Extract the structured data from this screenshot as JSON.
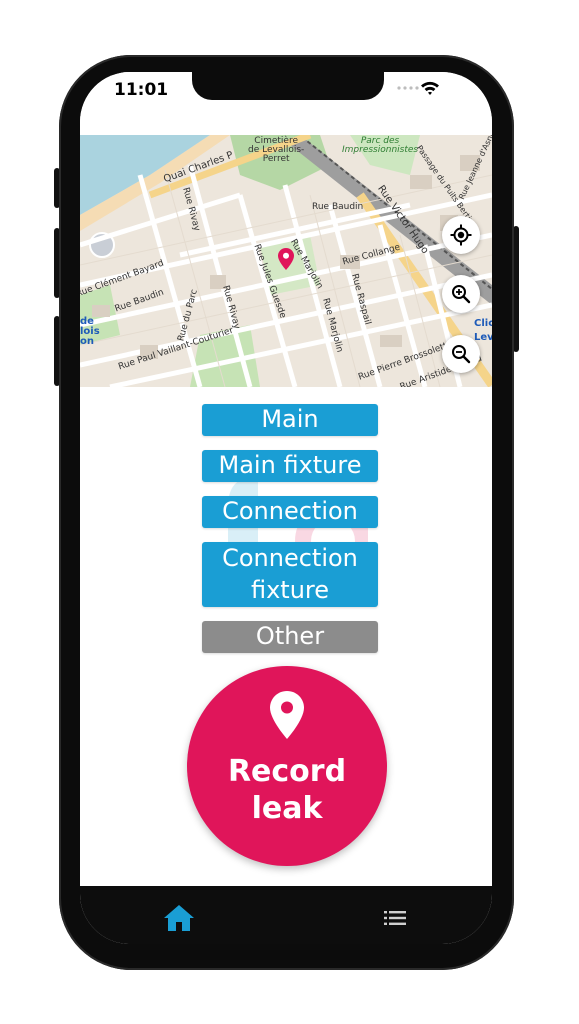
{
  "status_bar": {
    "time": "11:01"
  },
  "map": {
    "labels": {
      "quai": "Quai Charles P",
      "cimetiere": "Cimetière\nde Levallois-\nPerret",
      "parc": "Parc des\nImpressionnistes",
      "baudin_top": "Rue Baudin",
      "victor_hugo": "Rue Victor Hugo",
      "collange": "Rue Collange",
      "marjolin": "Rue Marjolin",
      "rivay": "Rue Rivay",
      "clement_bayard": "Rue Clément Bayard",
      "baudin_left": "Rue Baudin",
      "du_parc": "Rue du Parc",
      "paul_vaillant": "Rue Paul Vaillant-Couturier",
      "jules_guesde": "Rue Jules Guesde",
      "rivay_lower": "Rue Rivay",
      "raspail": "Rue Raspail",
      "marjolin_lower": "Rue Marjolin",
      "brossolette": "Rue Pierre Brossolette",
      "aristide": "Rue Aristide Briand",
      "passage": "Passage du Puits Bertin",
      "jeanne": "Rue Jeanne d'Asnières",
      "clic": "Clic",
      "leva": "Leva",
      "left_blue": "de\nlois\non"
    },
    "controls": {
      "locate_icon": "crosshair-locate-icon",
      "zoom_in_icon": "zoom-in-icon",
      "zoom_out_icon": "zoom-out-icon"
    }
  },
  "categories": [
    {
      "label": "Main"
    },
    {
      "label": "Main fixture"
    },
    {
      "label": "Connection"
    },
    {
      "label": "Connection\nfixture"
    },
    {
      "label": "Other"
    }
  ],
  "record": {
    "label": "Record\nleak",
    "icon": "map-pin-icon"
  },
  "nav": {
    "home_icon": "home-icon",
    "list_icon": "list-icon"
  },
  "colors": {
    "accent_blue": "#1a9ed4",
    "gray_button": "#8c8c8c",
    "record_pink": "#e0155a",
    "nav_bg": "#0d0d0d",
    "nav_active": "#1a9ed4"
  }
}
